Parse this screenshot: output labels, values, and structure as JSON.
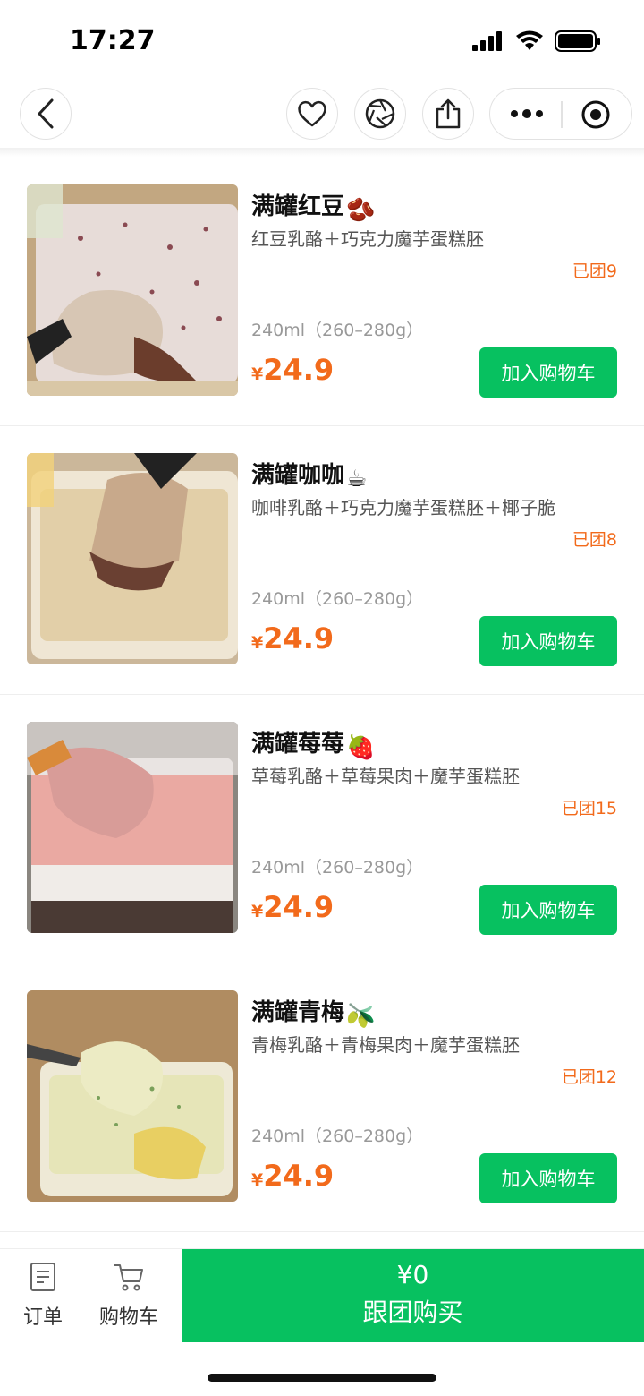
{
  "status": {
    "time": "17:27"
  },
  "products": [
    {
      "title": "满罐红豆",
      "emoji": "🫘",
      "desc": "红豆乳酪＋巧克力魔芋蛋糕胚",
      "group": "已团9",
      "spec": "240ml（260–280g）",
      "currency": "¥",
      "price": "24.9",
      "button": "加入购物车"
    },
    {
      "title": "满罐咖咖",
      "emoji": "☕",
      "desc": "咖啡乳酪＋巧克力魔芋蛋糕胚＋椰子脆",
      "group": "已团8",
      "spec": "240ml（260–280g）",
      "currency": "¥",
      "price": "24.9",
      "button": "加入购物车"
    },
    {
      "title": "满罐莓莓",
      "emoji": "🍓",
      "desc": "草莓乳酪＋草莓果肉＋魔芋蛋糕胚",
      "group": "已团15",
      "spec": "240ml（260–280g）",
      "currency": "¥",
      "price": "24.9",
      "button": "加入购物车"
    },
    {
      "title": "满罐青梅",
      "emoji": "🫒",
      "desc": "青梅乳酪＋青梅果肉＋魔芋蛋糕胚",
      "group": "已团12",
      "spec": "240ml（260–280g）",
      "currency": "¥",
      "price": "24.9",
      "button": "加入购物车"
    }
  ],
  "bottom": {
    "order_label": "订单",
    "cart_label": "购物车",
    "buy_price": "¥0",
    "buy_label": "跟团购买"
  },
  "colors": {
    "accent_green": "#07c160",
    "price_orange": "#f26a1b"
  }
}
